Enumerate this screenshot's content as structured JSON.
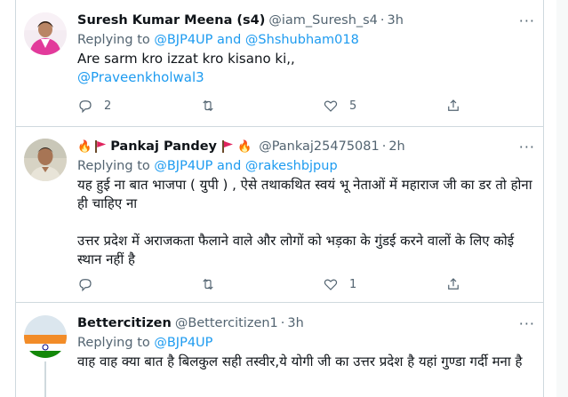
{
  "tweets": [
    {
      "name": "Suresh Kumar Meena (s4)",
      "handle": "@iam_Suresh_s4",
      "time": "3h",
      "replying_prefix": "Replying to",
      "replying_to": [
        "@BJP4UP",
        "@Shshubham018"
      ],
      "replying_join": "and",
      "text": "Are sarm kro izzat kro kisano ki,,",
      "mention_line": "@Praveenkholwal3",
      "replies": "2",
      "retweets": "",
      "likes": "5"
    },
    {
      "name": "Pankaj Pandey",
      "handle": "@Pankaj25475081",
      "time": "2h",
      "replying_prefix": "Replying to",
      "replying_to": [
        "@BJP4UP",
        "@rakeshbjpup"
      ],
      "replying_join": "and",
      "text_1": "यह हुई ना बात भाजपा ( युपी ) , ऐसे तथाकथित  स्वयं भू नेताओं में महाराज जी का डर तो होना ही चाहिए ना",
      "text_2": "उत्तर प्रदेश में अराजकता फैलाने वाले और लोगों को भड़का के गुंडई करने वालों के लिए कोई स्थान नहीं है",
      "replies": "",
      "retweets": "",
      "likes": "1"
    },
    {
      "name": "Bettercitizen",
      "handle": "@Bettercitizen1",
      "time": "3h",
      "replying_prefix": "Replying to",
      "replying_to": [
        "@BJP4UP"
      ],
      "text": "वाह वाह क्या बात है बिलकुल सही तस्वीर,ये योगी जी का उत्तर प्रदेश है यहां गुण्डा गर्दी मना है"
    }
  ],
  "separator": "·",
  "more_glyph": "···",
  "colors": {
    "link": "#1d9bf0",
    "muted": "#536471",
    "border": "#cfd9de"
  },
  "icons": [
    "reply-icon",
    "retweet-icon",
    "like-icon",
    "share-icon",
    "fire-emoji",
    "red-flag-emoji",
    "more-icon"
  ]
}
